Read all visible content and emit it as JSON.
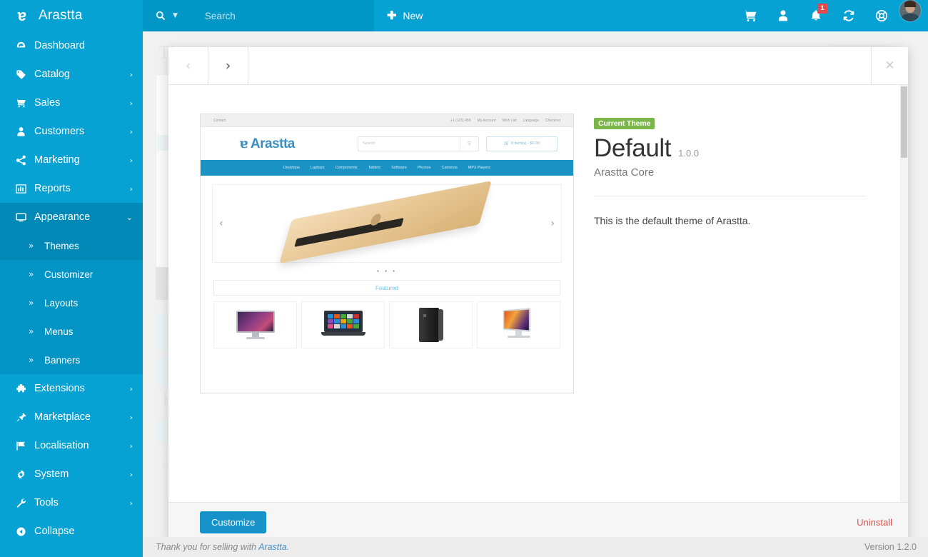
{
  "brand": {
    "name": "Arastta",
    "logo_glyph": "ɐ"
  },
  "sidebar": {
    "items": [
      {
        "label": "Dashboard",
        "icon": "dashboard-icon",
        "caret": ""
      },
      {
        "label": "Catalog",
        "icon": "tag-icon",
        "caret": "›"
      },
      {
        "label": "Sales",
        "icon": "cart-icon",
        "caret": "›"
      },
      {
        "label": "Customers",
        "icon": "user-icon",
        "caret": "›"
      },
      {
        "label": "Marketing",
        "icon": "share-icon",
        "caret": "›"
      },
      {
        "label": "Reports",
        "icon": "bar-chart-icon",
        "caret": "›"
      },
      {
        "label": "Appearance",
        "icon": "monitor-icon",
        "caret": "⌄"
      }
    ],
    "appearance_children": [
      {
        "label": "Themes",
        "chevron": "»",
        "current": true
      },
      {
        "label": "Customizer",
        "chevron": "»",
        "current": false
      },
      {
        "label": "Layouts",
        "chevron": "»",
        "current": false
      },
      {
        "label": "Menus",
        "chevron": "»",
        "current": false
      },
      {
        "label": "Banners",
        "chevron": "»",
        "current": false
      }
    ],
    "items_after": [
      {
        "label": "Extensions",
        "icon": "puzzle-icon",
        "caret": "›"
      },
      {
        "label": "Marketplace",
        "icon": "plug-icon",
        "caret": "›"
      },
      {
        "label": "Localisation",
        "icon": "flag-icon",
        "caret": "›"
      },
      {
        "label": "System",
        "icon": "gear-icon",
        "caret": "›"
      },
      {
        "label": "Tools",
        "icon": "wrench-icon",
        "caret": "›"
      },
      {
        "label": "Collapse",
        "icon": "collapse-icon",
        "caret": ""
      }
    ]
  },
  "topbar": {
    "search_placeholder": "Search",
    "search_value": "",
    "new_label": "New",
    "notification_count": "1",
    "icons": [
      "cart-icon",
      "user-icon",
      "bell-icon",
      "refresh-icon",
      "help-icon",
      "avatar"
    ]
  },
  "background_page": {
    "title": "Themes"
  },
  "modal": {
    "prev_label": "‹",
    "next_label": "›",
    "close_label": "✕",
    "theme": {
      "current_badge": "Current Theme",
      "name": "Default",
      "version": "1.0.0",
      "author": "Arastta Core",
      "description": "This is the default theme of Arastta."
    },
    "footer": {
      "customize_label": "Customize",
      "uninstall_label": "Uninstall"
    },
    "preview": {
      "top_links": [
        "Contact",
        "+1 (123) 456",
        "My Account",
        "Wish List",
        "Language",
        "Checkout"
      ],
      "logo": "Arastta",
      "search_placeholder": "Search",
      "search_icon": "magnifier-icon",
      "cart_label": "0 item(s) - $0.00",
      "nav": [
        "Desktops",
        "Laptops",
        "Components",
        "Tablets",
        "Software",
        "Phones",
        "Cameras",
        "MP3 Players"
      ],
      "hero_prev": "‹",
      "hero_next": "›",
      "carousel_dots": "▪ ▪ ▪",
      "featured_heading": "Featured",
      "products": [
        "monitor",
        "laptop",
        "tower",
        "imac"
      ]
    }
  },
  "page_footer": {
    "thanks_prefix": "Thank you for selling with ",
    "thanks_link": "Arastta",
    "thanks_suffix": ".",
    "version": "Version 1.2.0"
  },
  "colors": {
    "brand_blue": "#06a2d4",
    "brand_blue_dark": "#0089b6",
    "accent_button": "#1792c9",
    "badge_green": "#7ab648",
    "danger_red": "#d9534f",
    "notification_red": "#e8474b"
  }
}
